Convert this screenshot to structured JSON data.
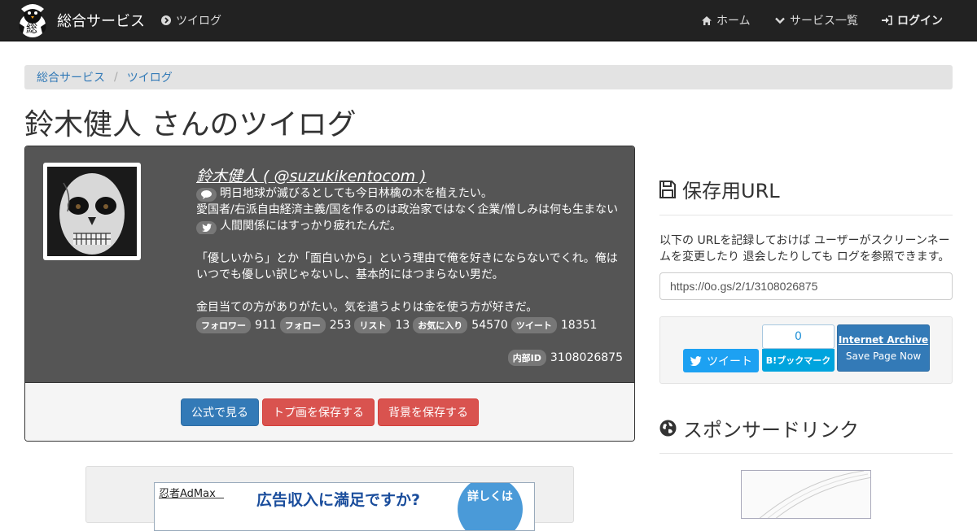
{
  "navbar": {
    "brand": "総合サービス",
    "logo_char": "総",
    "current_label": "ツイログ",
    "home_label": "ホーム",
    "services_label": "サービス一覧",
    "login_label": "ログイン"
  },
  "breadcrumb": [
    "総合サービス",
    "ツイログ"
  ],
  "page_title": "鈴木健人 さんのツイログ",
  "profile": {
    "name_line": "鈴木健人 ( @suzukikentocom )",
    "bio_line1": "明日地球が滅びるとしても今日林檎の木を植えたい。",
    "bio_line2": "愛国者/右派自由経済主義/国を作るのは政治家ではなく企業/憎しみは何も生まない",
    "bio_line3": "人間関係にはすっかり疲れたんだ。",
    "bio_line4": "「優しいから」とか「面白いから」という理由で俺を好きにならないでくれ。俺はいつでも優しい訳じゃないし、基本的にはつまらない男だ。",
    "bio_line5": "金目当ての方がありがたい。気を遣うよりは金を使う方が好きだ。",
    "stats": [
      {
        "label": "フォロワー",
        "value": "911"
      },
      {
        "label": "フォロー",
        "value": "253"
      },
      {
        "label": "リスト",
        "value": "13"
      },
      {
        "label": "お気に入り",
        "value": "54570"
      },
      {
        "label": "ツイート",
        "value": "18351"
      }
    ],
    "internal_id_label": "内部ID",
    "internal_id": "3108026875",
    "buttons": {
      "official": "公式で見る",
      "save_icon": "トプ画を保存する",
      "save_bg": "背景を保存する"
    }
  },
  "ad_left": {
    "brand": "忍者AdMax",
    "copy": "広告収入に満足ですか?",
    "circle": "詳しくは"
  },
  "sidebar": {
    "save_title": "保存用URL",
    "save_text": "以下の URLを記録しておけば ユーザーがスクリーンネームを変更したり 退会したりしても ログを参照できます。",
    "save_url": "https://0o.gs/2/1/3108026875",
    "tweet_label": "ツイート",
    "hatena_count": "0",
    "hatena_label": "B!ブックマーク",
    "ia_title": "Internet Archive",
    "ia_sub": "Save Page Now",
    "sponsor_title": "スポンサードリンク"
  },
  "colors": {
    "navbar_bg": "#222222",
    "link": "#337ab7",
    "btn_primary": "#337ab7",
    "btn_danger": "#d9534f",
    "profile_bg": "#555555"
  }
}
